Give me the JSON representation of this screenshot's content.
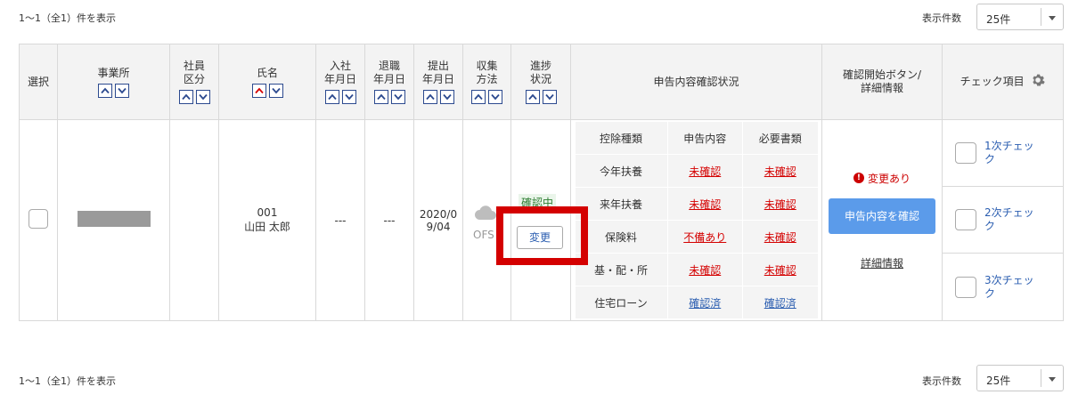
{
  "pagination": {
    "count_text": "1～1（全1）件を表示",
    "per_page_label": "表示件数",
    "per_page_value": "25件"
  },
  "headers": {
    "select": "選択",
    "office": "事業所",
    "emp_type_1": "社員",
    "emp_type_2": "区分",
    "name": "氏名",
    "hire_1": "入社",
    "hire_2": "年月日",
    "retire_1": "退職",
    "retire_2": "年月日",
    "submit_1": "提出",
    "submit_2": "年月日",
    "collect_1": "収集",
    "collect_2": "方法",
    "progress_1": "進捗",
    "progress_2": "状況",
    "declaration": "申告内容確認状況",
    "confirm_1": "確認開始ボタン/",
    "confirm_2": "詳細情報",
    "check_items": "チェック項目"
  },
  "row": {
    "emp_no": "001",
    "name": "山田 太郎",
    "hire_date": "---",
    "retire_date": "---",
    "submit_date_1": "2020/0",
    "submit_date_2": "9/04",
    "collect_method": "OFS",
    "status": "確認中",
    "change_button": "変更",
    "inner": {
      "header": [
        "控除種類",
        "申告内容",
        "必要書類"
      ],
      "rows": [
        {
          "type": "今年扶養",
          "declaration": "未確認",
          "docs": "未確認"
        },
        {
          "type": "来年扶養",
          "declaration": "未確認",
          "docs": "未確認"
        },
        {
          "type": "保険料",
          "declaration": "不備あり",
          "docs": "未確認"
        },
        {
          "type": "基・配・所",
          "declaration": "未確認",
          "docs": "未確認"
        },
        {
          "type": "住宅ローン",
          "declaration": "確認済",
          "docs": "確認済"
        }
      ]
    },
    "change_note": "変更あり",
    "confirm_button": "申告内容を確認",
    "detail_link": "詳細情報",
    "checks": [
      "1次チェック",
      "2次チェック",
      "3次チェック"
    ]
  },
  "colors": {
    "accent_blue": "#5b9bea",
    "warning_red": "#d40000",
    "link_blue": "#2a5db0",
    "status_green": "#2e7d32"
  }
}
